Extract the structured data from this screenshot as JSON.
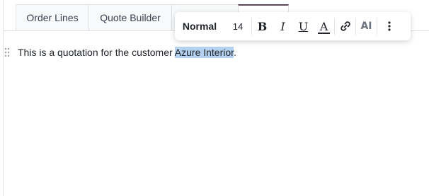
{
  "tabs": [
    {
      "label": "Order Lines"
    },
    {
      "label": "Quote Builder"
    },
    {
      "label": ""
    },
    {
      "label": ""
    }
  ],
  "toolbar": {
    "style_label": "Normal",
    "font_size": "14",
    "bold_label": "B",
    "italic_label": "I",
    "underline_label": "U",
    "font_color_label": "A",
    "ai_label": "AI"
  },
  "editor": {
    "text_before": "This is a quotation for the customer ",
    "text_selected": "Azure Interior",
    "text_after": "."
  },
  "colors": {
    "selection": "#b4d2f0",
    "active_tab_accent": "#5f4a5a"
  },
  "icons": [
    "drag-handle-icon",
    "link-icon",
    "more-options-icon"
  ]
}
